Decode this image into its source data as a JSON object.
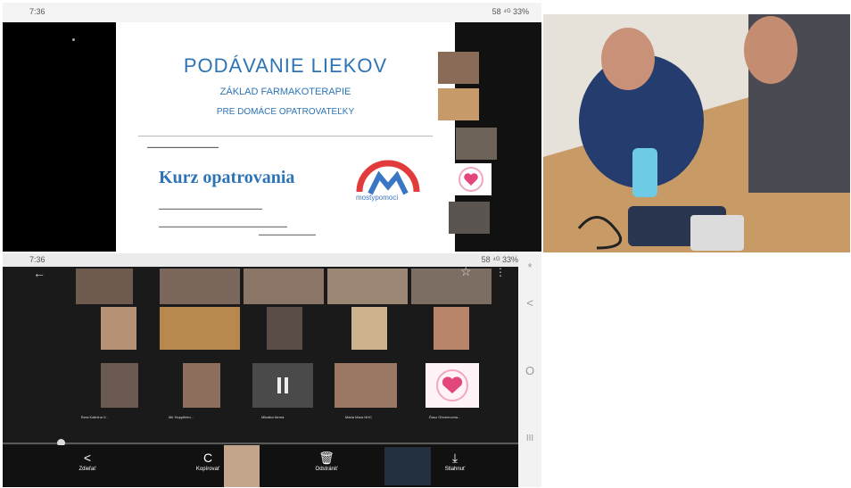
{
  "top": {
    "status_time": "7:36",
    "status_system": "58 ⁴ᴳ 33%",
    "slide": {
      "title": "PODÁVANIE  LIEKOV",
      "subtitle1": "ZÁKLAD  FARMAKOTERAPIE",
      "subtitle2": "PRE DOMÁCE OPATROVATEĽKY",
      "course": "Kurz opatrovania",
      "logo_text": "mostypomoci"
    }
  },
  "bottom": {
    "status_time": "7:36",
    "status_system": "58 ⁴ᴳ 33%",
    "participants": [
      "Bóra Kalinina V...",
      "Mir Hoppfleim...",
      "Mikalka Nemá",
      "Mária Mara NHC",
      "Ďasz Ohnemocha..."
    ],
    "actions": [
      {
        "icon": "<",
        "label": "Zdieľať"
      },
      {
        "icon": "C",
        "label": "Kopírovať"
      },
      {
        "icon": "🗑",
        "label": "Odstrániť"
      },
      {
        "icon": "⤓",
        "label": "Stiahnuť"
      }
    ],
    "nav": [
      "*",
      "<",
      "O",
      "III"
    ]
  },
  "colors": {
    "accent": "#2e74b5",
    "logo_red": "#e23b3b",
    "logo_blue": "#3a76c4"
  }
}
